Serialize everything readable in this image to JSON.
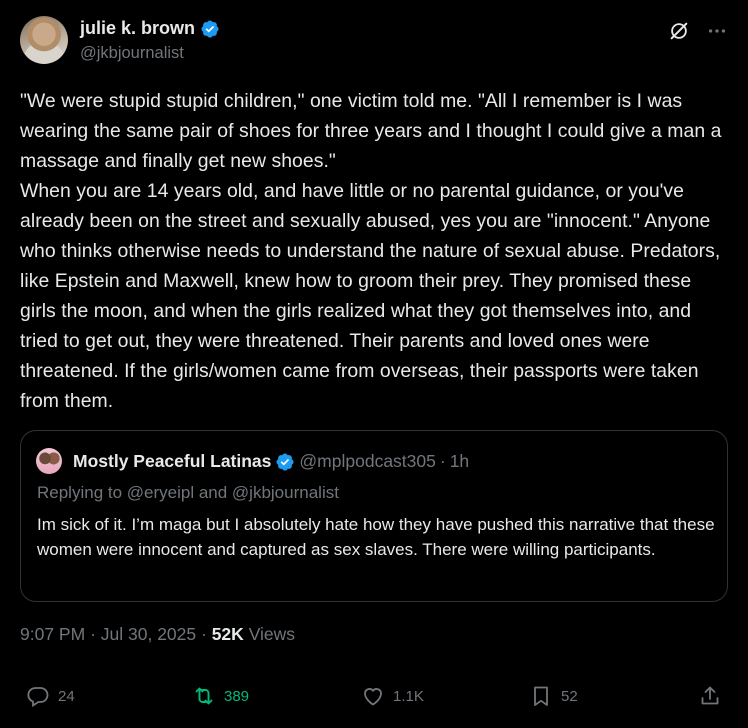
{
  "author": {
    "name": "julie k. brown",
    "handle": "@jkbjournalist",
    "verified_color": "#1d9bf0"
  },
  "icons": {
    "grok": "grok-icon",
    "more": "more-icon",
    "verified": "verified-badge-icon"
  },
  "tweet": {
    "text": "\"We were stupid stupid children,\" one victim told me. \"All I remember is I was wearing the same pair of shoes for three years and I thought I could give a man a massage and finally get new shoes.\"\nWhen you are 14 years old, and have little or no parental guidance, or you've already been on the street and sexually abused, yes you are \"innocent.\" Anyone who thinks otherwise needs to understand the nature of sexual abuse. Predators, like Epstein and Maxwell, knew how to groom their prey. They promised these girls the moon, and when the girls realized what they got themselves into, and tried to get out, they were threatened. Their parents and loved ones were threatened. If the girls/women came from overseas, their passports were taken from them."
  },
  "quote": {
    "name": "Mostly Peaceful Latinas",
    "handle": "@mplpodcast305",
    "dot": "·",
    "time": "1h",
    "reply_line": "Replying to @eryeipl and @jkbjournalist",
    "text": "Im sick of it. I’m maga but I absolutely hate how they have pushed this narrative that these women were innocent and captured as sex slaves. There were willing participants."
  },
  "meta": {
    "time": "9:07 PM",
    "sep": "·",
    "date": "Jul 30, 2025",
    "views_count": "52K",
    "views_label": "Views"
  },
  "actions": {
    "replies": "24",
    "reposts": "389",
    "likes": "1.1K",
    "bookmarks": "52",
    "repost_color": "#00ba7c"
  }
}
